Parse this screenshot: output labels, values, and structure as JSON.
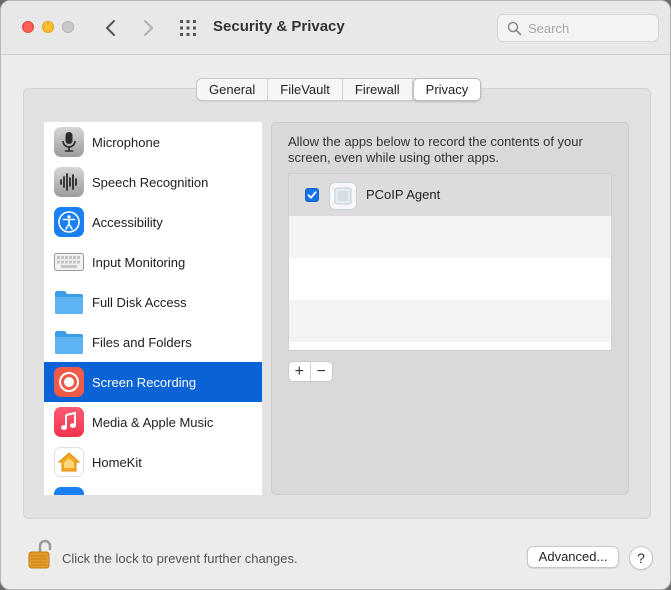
{
  "window": {
    "title": "Security & Privacy"
  },
  "search": {
    "placeholder": "Search"
  },
  "tabs": [
    {
      "label": "General"
    },
    {
      "label": "FileVault"
    },
    {
      "label": "Firewall"
    },
    {
      "label": "Privacy"
    }
  ],
  "sidebar": {
    "items": [
      {
        "label": "Microphone",
        "icon": "microphone-icon"
      },
      {
        "label": "Speech Recognition",
        "icon": "waveform-icon"
      },
      {
        "label": "Accessibility",
        "icon": "accessibility-icon"
      },
      {
        "label": "Input Monitoring",
        "icon": "keyboard-icon"
      },
      {
        "label": "Full Disk Access",
        "icon": "folder-icon"
      },
      {
        "label": "Files and Folders",
        "icon": "folder-icon"
      },
      {
        "label": "Screen Recording",
        "icon": "record-icon"
      },
      {
        "label": "Media & Apple Music",
        "icon": "music-note-icon"
      },
      {
        "label": "HomeKit",
        "icon": "home-icon"
      }
    ],
    "selected": "Screen Recording"
  },
  "main": {
    "description": "Allow the apps below to record the contents of your screen, even while using other apps.",
    "apps": [
      {
        "name": "PCoIP Agent",
        "checked": true
      }
    ],
    "add_label": "+",
    "remove_label": "−"
  },
  "footer": {
    "lock_text": "Click the lock to prevent further changes.",
    "advanced_label": "Advanced...",
    "help_label": "?"
  },
  "colors": {
    "accent": "#0a63d6",
    "close": "#fe5f57",
    "minimize": "#febc2e"
  }
}
